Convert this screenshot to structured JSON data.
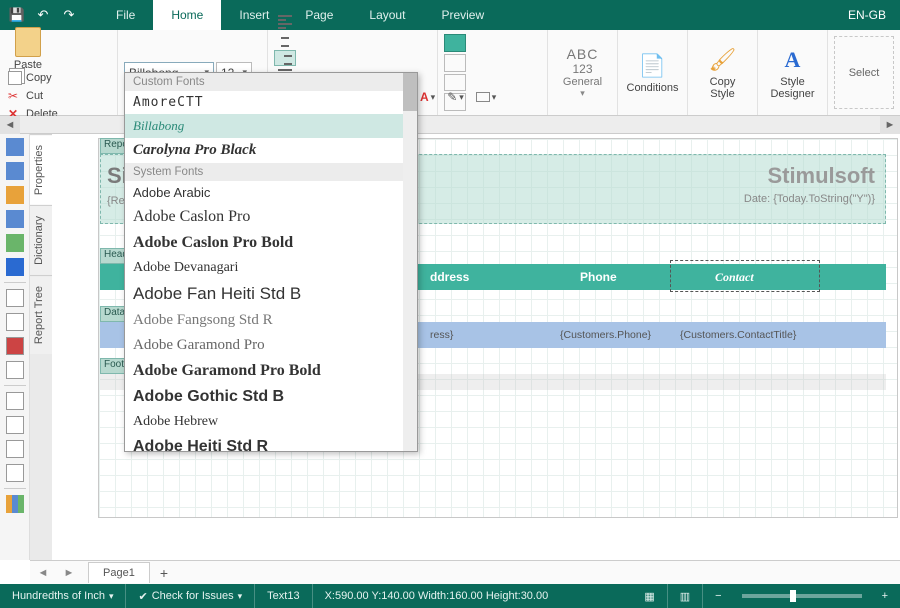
{
  "titlebar": {
    "lang": "EN-GB"
  },
  "tabs": {
    "file": "File",
    "home": "Home",
    "insert": "Insert",
    "page": "Page",
    "layout": "Layout",
    "preview": "Preview"
  },
  "clipboard": {
    "paste": "Paste",
    "copy": "Copy",
    "cut": "Cut",
    "delete": "Delete"
  },
  "font": {
    "name": "Billabong",
    "size": "12"
  },
  "abc": {
    "abc": "ABC",
    "num": "123",
    "label": "General"
  },
  "buttons": {
    "conditions": "Conditions",
    "copystyle": "Copy\nStyle",
    "styledesigner": "Style\nDesigner",
    "select": "Select"
  },
  "font_dd": {
    "hdr_custom": "Custom Fonts",
    "custom": [
      "AmoreCTT",
      "Billabong",
      "Carolyna Pro Black"
    ],
    "hdr_system": "System Fonts",
    "system": [
      "Adobe Arabic",
      "Adobe Caslon Pro",
      "Adobe Caslon Pro Bold",
      "Adobe Devanagari",
      "Adobe Fan Heiti Std B",
      "Adobe Fangsong Std R",
      "Adobe Garamond Pro",
      "Adobe Garamond Pro Bold",
      "Adobe Gothic Std B",
      "Adobe Hebrew",
      "Adobe Heiti Std R"
    ]
  },
  "vtabs": {
    "properties": "Properties",
    "dictionary": "Dictionary",
    "reporttree": "Report Tree"
  },
  "bands": {
    "report_label": "Repo",
    "header_label": "Head",
    "data_label": "Data",
    "footer_label": "Foot",
    "si": "Si",
    "repdesc": "{Rep",
    "brand": "Stimulsoft",
    "datestr": "Date: {Today.ToString(\"Y\")}",
    "col_address": "ddress",
    "col_phone": "Phone",
    "col_contact": "Contact",
    "data_address": "ress}",
    "data_phone": "{Customers.Phone}",
    "data_contact": "{Customers.ContactTitle}"
  },
  "pagetabs": {
    "page1": "Page1"
  },
  "status": {
    "unit": "Hundredths of Inch",
    "check": "Check for Issues",
    "obj": "Text13",
    "coords": "X:590.00 Y:140.00 Width:160.00 Height:30.00"
  }
}
